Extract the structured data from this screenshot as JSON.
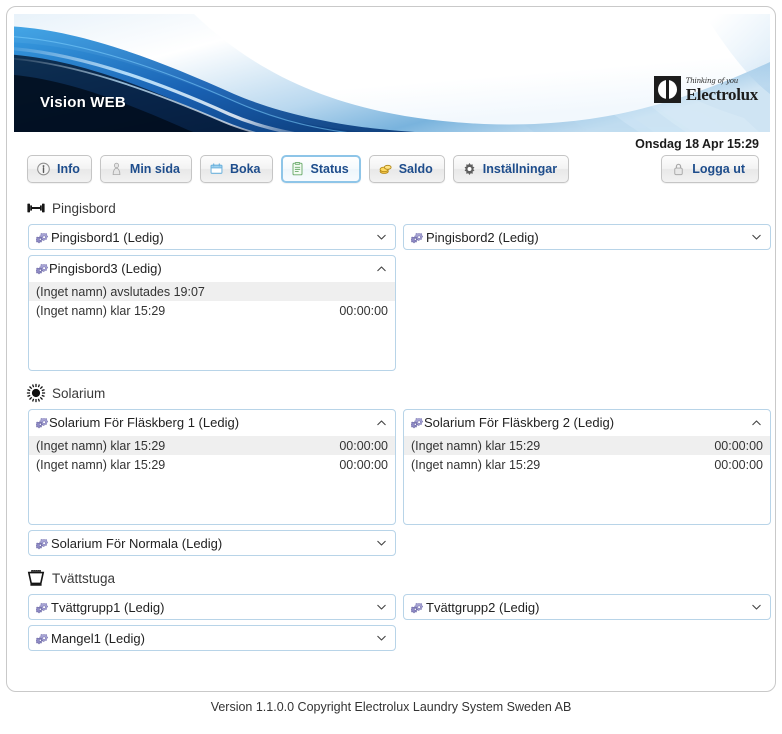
{
  "app": {
    "banner_title": "Vision WEB",
    "logo_tagline": "Thinking of you",
    "logo_name": "Electrolux"
  },
  "header": {
    "datetime": "Onsdag 18 Apr 15:29"
  },
  "toolbar": {
    "items": [
      {
        "label": "Info",
        "icon": "info-icon",
        "active": false
      },
      {
        "label": "Min sida",
        "icon": "person-icon",
        "active": false
      },
      {
        "label": "Boka",
        "icon": "calendar-icon",
        "active": false
      },
      {
        "label": "Status",
        "icon": "list-icon",
        "active": true
      },
      {
        "label": "Saldo",
        "icon": "coins-icon",
        "active": false
      },
      {
        "label": "Inställningar",
        "icon": "gear-icon",
        "active": false
      }
    ],
    "logout": {
      "label": "Logga ut",
      "icon": "lock-icon"
    }
  },
  "sections": [
    {
      "id": "pingisbord",
      "title": "Pingisbord",
      "icon": "barbell-icon",
      "rows": [
        {
          "left": {
            "kind": "select",
            "label": "Pingisbord1 (Ledig)",
            "icon": "machine-gear-icon"
          },
          "right": {
            "kind": "select",
            "label": "Pingisbord2 (Ledig)",
            "icon": "machine-gear-icon"
          }
        },
        {
          "left": {
            "kind": "panel",
            "label": "Pingisbord3 (Ledig)",
            "icon": "machine-gear-icon",
            "entries": [
              {
                "text": "(Inget namn) avslutades 19:07",
                "time": ""
              },
              {
                "text": "(Inget namn) klar 15:29",
                "time": "00:00:00"
              }
            ]
          },
          "right": {
            "kind": "empty"
          }
        }
      ]
    },
    {
      "id": "solarium",
      "title": "Solarium",
      "icon": "sun-icon",
      "rows": [
        {
          "left": {
            "kind": "panel",
            "label": "Solarium För Fläskberg 1 (Ledig)",
            "icon": "machine-gear-icon",
            "entries": [
              {
                "text": "(Inget namn) klar 15:29",
                "time": "00:00:00"
              },
              {
                "text": "(Inget namn) klar 15:29",
                "time": "00:00:00"
              }
            ]
          },
          "right": {
            "kind": "panel",
            "label": "Solarium För Fläskberg 2 (Ledig)",
            "icon": "machine-gear-icon",
            "entries": [
              {
                "text": "(Inget namn) klar 15:29",
                "time": "00:00:00"
              },
              {
                "text": "(Inget namn) klar 15:29",
                "time": "00:00:00"
              }
            ]
          }
        },
        {
          "left": {
            "kind": "select",
            "label": "Solarium För Normala (Ledig)",
            "icon": "machine-gear-icon"
          },
          "right": {
            "kind": "empty"
          }
        }
      ]
    },
    {
      "id": "tvattstuga",
      "title": "Tvättstuga",
      "icon": "wash-tub-icon",
      "rows": [
        {
          "left": {
            "kind": "select",
            "label": "Tvättgrupp1 (Ledig)",
            "icon": "machine-gear-icon"
          },
          "right": {
            "kind": "select",
            "label": "Tvättgrupp2 (Ledig)",
            "icon": "machine-gear-icon"
          }
        },
        {
          "left": {
            "kind": "select",
            "label": "Mangel1 (Ledig)",
            "icon": "machine-gear-icon"
          },
          "right": {
            "kind": "empty"
          }
        }
      ]
    }
  ],
  "footer": {
    "text": "Version 1.1.0.0 Copyright Electrolux Laundry System Sweden AB"
  },
  "colors": {
    "accent_blue": "#1e4d8c",
    "border_blue": "#b8d4e8",
    "active_border": "#8ec5e8",
    "row_alt": "#efefef",
    "banner_deep": "#0a3f8f"
  }
}
